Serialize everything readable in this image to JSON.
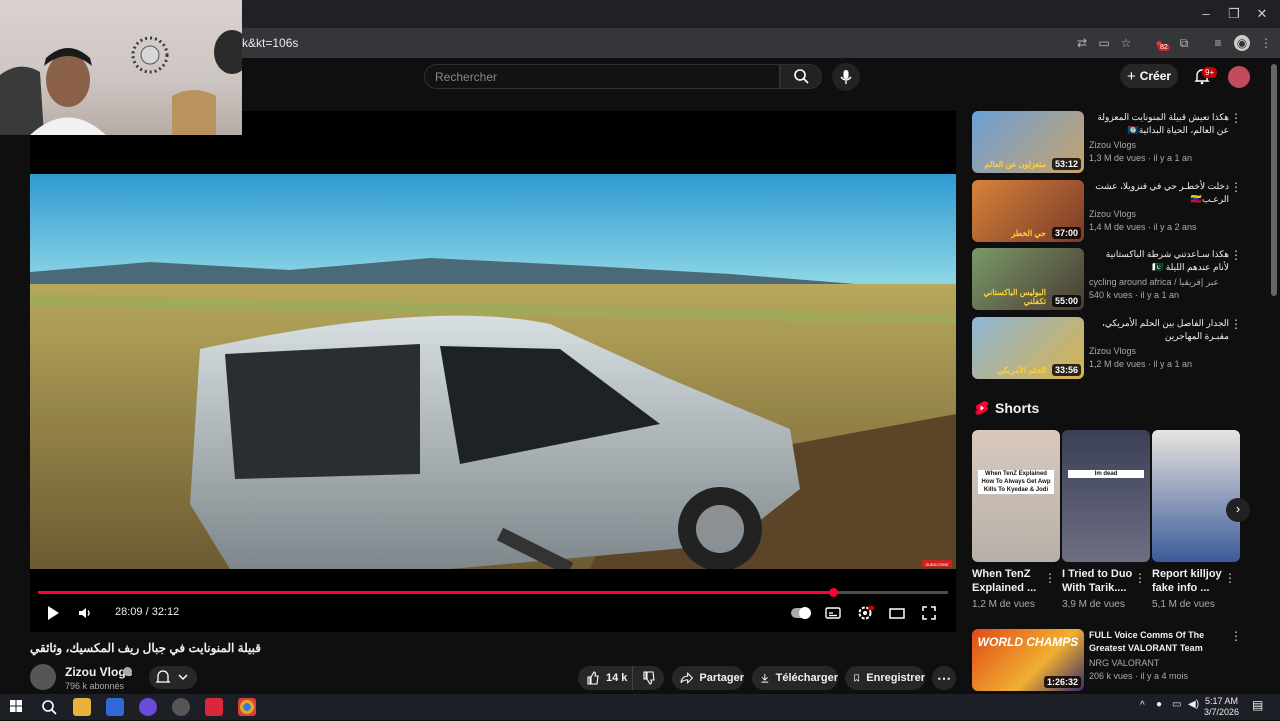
{
  "browser": {
    "url_fragment": "k&kt=106s",
    "window_controls": [
      "minimize-icon",
      "restore-icon",
      "close-icon"
    ],
    "toolbar_badge": "82"
  },
  "youtube_header": {
    "search_placeholder": "Rechercher",
    "create_label": "Créer",
    "notification_badge": "9+"
  },
  "player": {
    "time": "28:09 / 32:12",
    "progress_fraction": 0.874,
    "overlay_label": "SUBSCRIBE"
  },
  "video": {
    "title": "قبيلة المنونايت في جبال ريف المكسيك، وثائقي",
    "channel": "Zizou Vlogs",
    "subscribers": "796 k abonnés",
    "likes": "14 k",
    "share_label": "Partager",
    "download_label": "Télécharger",
    "save_label": "Enregistrer"
  },
  "recommendations": [
    {
      "title": "هكذا تعيش قبيلة المنونايت المعزولة عن العالم، الحياة البدائية🇧🇿",
      "channel": "Zizou Vlogs",
      "meta": "1,3 M de vues · il y a 1 an",
      "duration": "53:12",
      "thumb_text": "منعزلون عن العالم",
      "colors": [
        "#6aa0d8",
        "#c9a26a"
      ]
    },
    {
      "title": "دخلت لأخطـر حي في فنزويلا، عشت الرعـب🇻🇪",
      "channel": "Zizou Vlogs",
      "meta": "1,4 M de vues · il y a 2 ans",
      "duration": "37:00",
      "thumb_text": "حي الخطر",
      "colors": [
        "#d8833a",
        "#7a3a2a"
      ]
    },
    {
      "title": "هكذا سـاعدتني شرطة الباكستانية لأنام عندهم الليلة 🇵🇰",
      "channel": "cycling around africa / عبر إفريقيا",
      "meta": "540 k vues · il y a 1 an",
      "duration": "55:00",
      "thumb_text": "البوليس الباكستاني تكفلني",
      "colors": [
        "#7a9a6a",
        "#4a3a32"
      ]
    },
    {
      "title": "الجدار الفاصل بين الحلم الأمريكي، مقبـرة المهاجرين",
      "channel": "Zizou Vlogs",
      "meta": "1,2 M de vues · il y a 1 an",
      "duration": "33:56",
      "thumb_text": "الحلم الأمريكي",
      "colors": [
        "#8fb6d8",
        "#d8b24a"
      ]
    }
  ],
  "shorts": {
    "heading": "Shorts",
    "items": [
      {
        "title": "When TenZ Explained ...",
        "views": "1,2 M de vues",
        "caption": "When TenZ Explained How To Always Get Awp Kills To Kyedae & Jodi",
        "colors": [
          "#d9c9bd",
          "#b7b0a8"
        ]
      },
      {
        "title": "I Tried to Duo With Tarik....",
        "views": "3,9 M de vues",
        "caption": "Im dead",
        "colors": [
          "#3a3f55",
          "#6d6f82"
        ]
      },
      {
        "title": "Report killjoy fake info ...",
        "views": "5,1 M de vues",
        "caption": "",
        "colors": [
          "#e9e4e0",
          "#3b5a9a"
        ]
      }
    ]
  },
  "bottom_rec": {
    "title": "FULL Voice Comms Of The Greatest VALORANT Team",
    "channel": "NRG VALORANT",
    "meta": "206 k vues · il y a 4 mois",
    "duration": "1:26:32",
    "thumb_text": "WORLD CHAMPS"
  },
  "taskbar": {
    "time": "5:17 AM",
    "date": "3/7/2026"
  }
}
